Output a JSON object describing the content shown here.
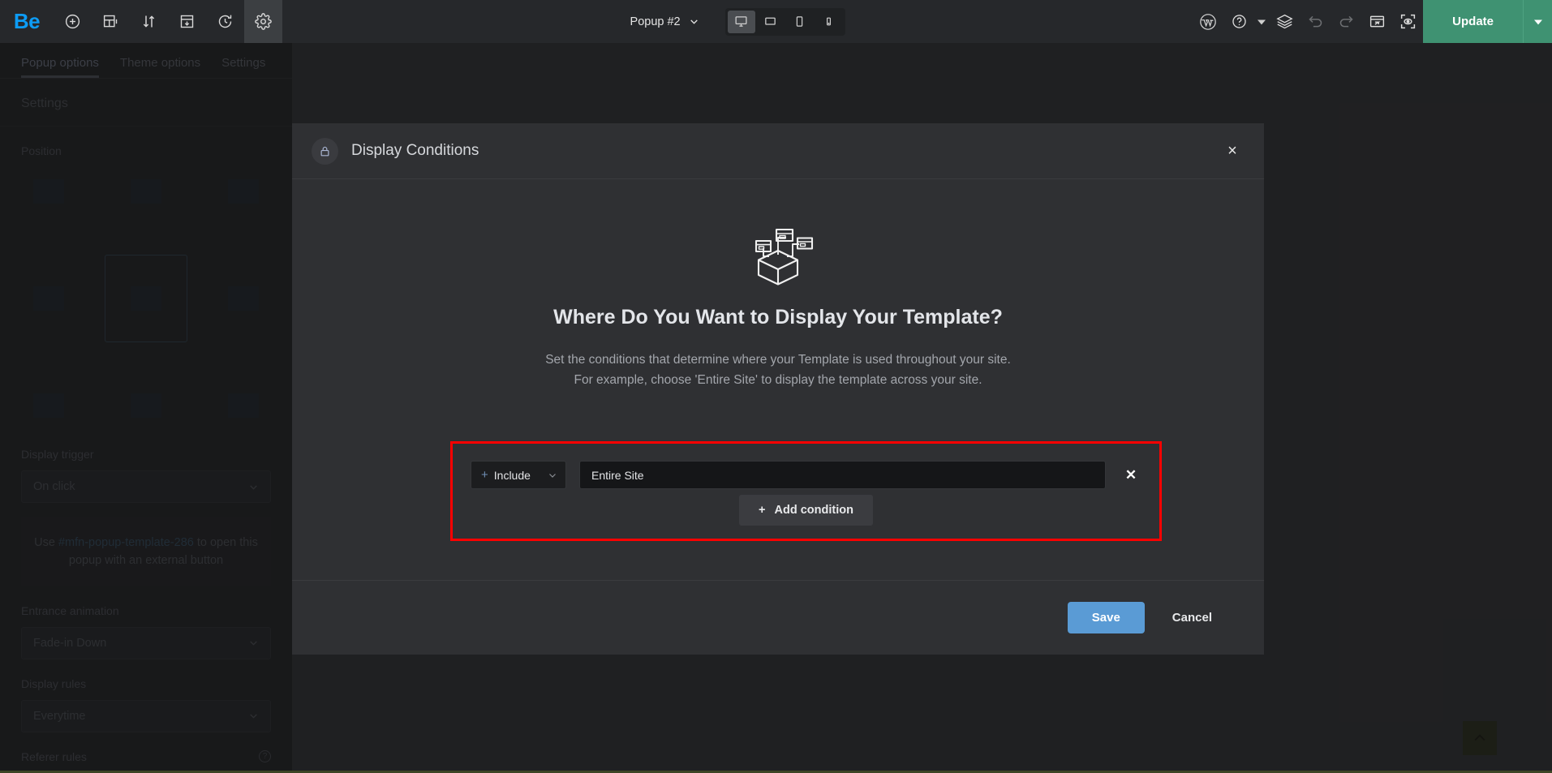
{
  "topbar": {
    "logo": "Be",
    "left_icons": [
      {
        "name": "add-element-icon",
        "label": "Add element"
      },
      {
        "name": "add-section-icon",
        "label": "Add section"
      },
      {
        "name": "reorder-icon",
        "label": "Reorder"
      },
      {
        "name": "templates-icon",
        "label": "Templates"
      },
      {
        "name": "history-icon",
        "label": "History"
      },
      {
        "name": "gear-icon",
        "label": "Settings"
      }
    ],
    "document_title": "Popup #2",
    "devices": [
      {
        "name": "desktop-icon",
        "label": "Desktop",
        "active": true
      },
      {
        "name": "laptop-icon",
        "label": "Laptop",
        "active": false
      },
      {
        "name": "tablet-icon",
        "label": "Tablet",
        "active": false
      },
      {
        "name": "mobile-icon",
        "label": "Mobile",
        "active": false
      }
    ],
    "right_icons": [
      {
        "name": "wordpress-icon",
        "label": "WordPress"
      },
      {
        "name": "help-icon",
        "label": "Help"
      },
      {
        "name": "layers-icon",
        "label": "Layers"
      },
      {
        "name": "undo-icon",
        "label": "Undo"
      },
      {
        "name": "redo-icon",
        "label": "Redo"
      },
      {
        "name": "responsive-preview-icon",
        "label": "Preview in browser"
      },
      {
        "name": "preview-icon",
        "label": "Preview"
      }
    ],
    "update_label": "Update",
    "accent_green": "#3f9272",
    "logo_blue": "#0d9cf5"
  },
  "sidebar": {
    "tabs": [
      {
        "label": "Popup options",
        "active": true
      },
      {
        "label": "Theme options",
        "active": false
      },
      {
        "label": "Settings",
        "active": false
      }
    ],
    "section_title": "Settings",
    "position_label": "Position",
    "position_cells": [
      {
        "h": "left",
        "v": "top",
        "selected": false
      },
      {
        "h": "center",
        "v": "top",
        "selected": false
      },
      {
        "h": "right",
        "v": "top",
        "selected": false
      },
      {
        "h": "left",
        "v": "middle",
        "selected": false
      },
      {
        "h": "center",
        "v": "middle",
        "selected": true
      },
      {
        "h": "right",
        "v": "middle",
        "selected": false
      },
      {
        "h": "left",
        "v": "bottom",
        "selected": false
      },
      {
        "h": "center",
        "v": "bottom",
        "selected": false
      },
      {
        "h": "right",
        "v": "bottom",
        "selected": false
      }
    ],
    "display_trigger_label": "Display trigger",
    "display_trigger_value": "On click",
    "note_prefix": "Use ",
    "note_code": "#mfn-popup-template-286",
    "note_suffix": " to open this popup with an external button",
    "entrance_animation_label": "Entrance animation",
    "entrance_animation_value": "Fade-in Down",
    "display_rules_label": "Display rules",
    "display_rules_value": "Everytime",
    "referer_rules_label": "Referer rules"
  },
  "modal": {
    "title": "Display Conditions",
    "icon": "lock-icon",
    "close_label": "×",
    "heading": "Where Do You Want to Display Your Template?",
    "description_line1": "Set the conditions that determine where your Template is used throughout your site.",
    "description_line2": "For example, choose 'Entire Site' to display the template across your site.",
    "highlight_color": "#fe0000",
    "condition": {
      "type_plus": "+",
      "type_value": "Include",
      "target_value": "Entire Site",
      "remove_label": "✕"
    },
    "add_condition_label": "Add condition",
    "add_condition_plus": "+",
    "save_label": "Save",
    "cancel_label": "Cancel",
    "save_color": "#5a9bd5"
  },
  "misc": {
    "scroll_top_name": "scroll-to-top-button"
  }
}
